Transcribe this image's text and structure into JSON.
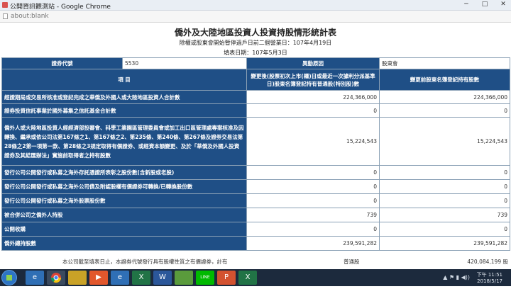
{
  "browser": {
    "window_title": "公開資訊觀測站 - Google Chrome",
    "url": "about:blank",
    "buttons": [
      "─",
      "□",
      "✕"
    ]
  },
  "report": {
    "title": "僑外及大陸地區投資人投資持股情形統計表",
    "subtitle": "除權或股東會開始暫停過戶日前二個營業日：107年4月19日",
    "fill_date": "填表日期：107年5月3日",
    "stock_code_label": "證券代號",
    "stock_code_value": "5530",
    "change_reason_label": "異動原因",
    "change_reason_value": "股東會",
    "columns": {
      "item": "項  目",
      "col_a": "變更後(股票初次上市(櫃)日或最近一次據利分派基準日)股東名簿登記持有普通股(特別股)數",
      "col_b": "變更前股東名簿登記持有股數"
    },
    "rows": [
      {
        "label": "經證期局或交易所核准或登記完成之華僑及外國人或大陸地區投資人合計數",
        "a": "224,366,000",
        "b": "224,366,000"
      },
      {
        "label": "證券投資信託事業於國外募集之信託基金合計數",
        "a": "0",
        "b": "0"
      },
      {
        "label": "僑外人或大陸地區投資人經經濟部投審會、科學工業園區管理委員會或加工出口區管理處專案核准及因轉換、繼承或依公司法第167條之1、第167條之2、第235條、第240條、第267條及證券交易法第28條之2第一項第一款、第28條之3規定取得有價證券、或經資本額變更、及於「華僑及外國人投資證券及其結匯辦法」實施前取得者之持有股數",
        "a": "15,224,543",
        "b": "15,224,543"
      },
      {
        "label": "發行公司公開發行或私募之海外存託憑證所表彰之股份數(含新股或老股)",
        "a": "0",
        "b": "0"
      },
      {
        "label": "發行公司公開發行或私募之海外公司債及附認股權有價證券可轉換/已轉換股份數",
        "a": "0",
        "b": "0"
      },
      {
        "label": "發行公司公開發行或私募之海外股票股份數",
        "a": "0",
        "b": "0"
      },
      {
        "label": "被合併公司之僑外人持股",
        "a": "739",
        "b": "739"
      },
      {
        "label": "公開收購",
        "a": "0",
        "b": "0"
      },
      {
        "label": "僑外總持股數",
        "a": "239,591,282",
        "b": "239,591,282"
      }
    ],
    "footnote_text": "本公司截至填表日止，本證券代號發行具有股權性質之有價證券，計有",
    "common_label": "普通股",
    "common_value": "420,084,199 股"
  },
  "taskbar": {
    "apps": [
      "ie",
      "chrome",
      "explorer",
      "media",
      "folder",
      "excel",
      "word",
      "line",
      "app-p",
      "excel2"
    ],
    "time": "下午 11:51",
    "date": "2018/5/17"
  }
}
